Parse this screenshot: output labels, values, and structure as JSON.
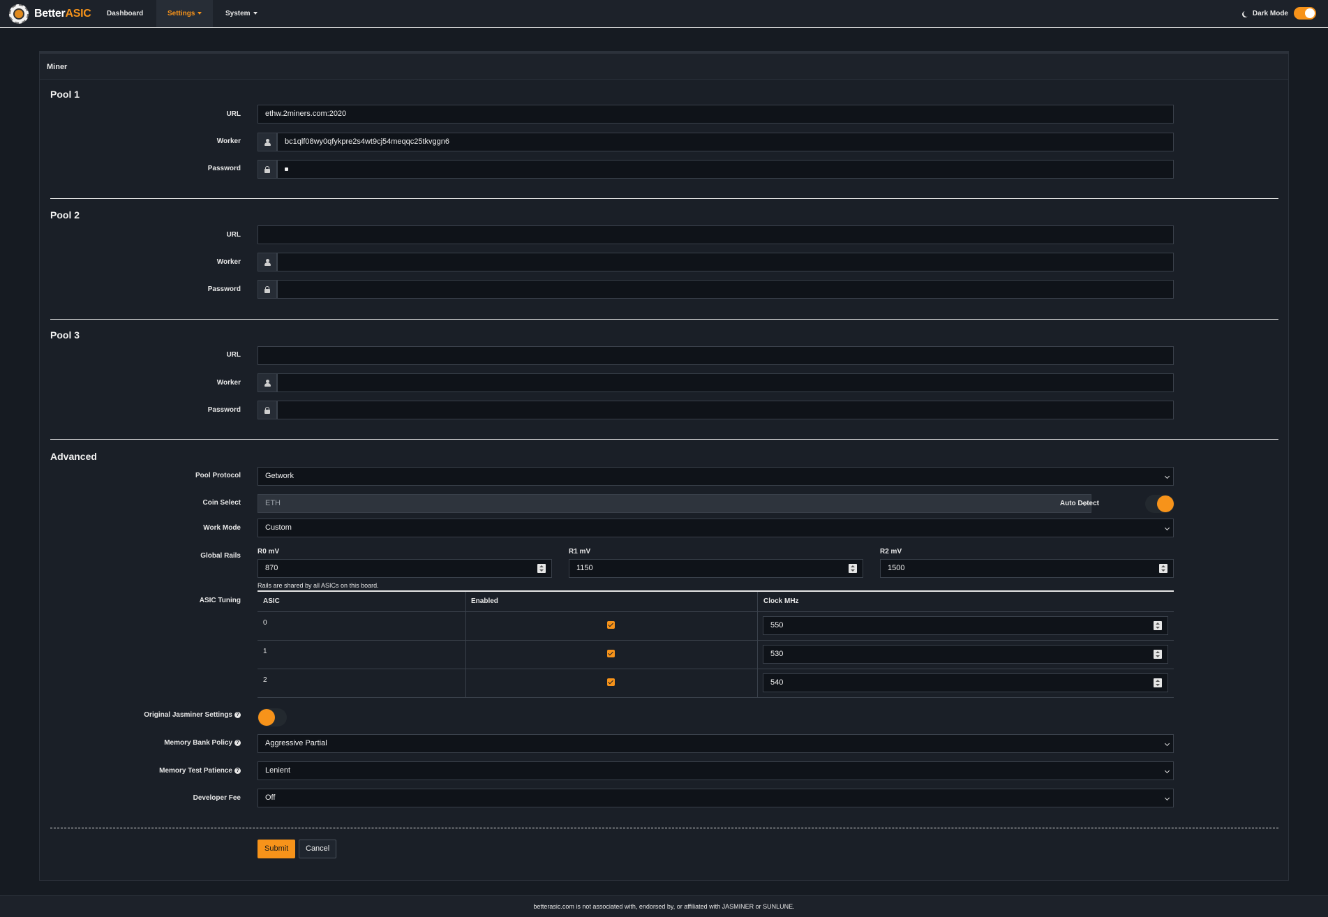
{
  "nav": {
    "brand_part1": "Better",
    "brand_part2": "ASIC",
    "items": [
      "Dashboard",
      "Settings",
      "System"
    ],
    "dark_mode_label": "Dark Mode"
  },
  "card": {
    "title": "Miner"
  },
  "labels": {
    "url": "URL",
    "worker": "Worker",
    "password": "Password"
  },
  "pools": [
    {
      "title": "Pool 1",
      "url": "ethw.2miners.com:2020",
      "worker": "bc1qlf08wy0qfykpre2s4wt9cj54meqqc25tkvggn6",
      "password_masked": true
    },
    {
      "title": "Pool 2",
      "url": "",
      "worker": "",
      "password_masked": false
    },
    {
      "title": "Pool 3",
      "url": "",
      "worker": "",
      "password_masked": false
    }
  ],
  "advanced": {
    "title": "Advanced",
    "pool_protocol_label": "Pool Protocol",
    "pool_protocol": "Getwork",
    "coin_select_label": "Coin Select",
    "coin_select": "ETH",
    "auto_detect_label": "Auto Detect",
    "work_mode_label": "Work Mode",
    "work_mode": "Custom",
    "global_rails_label": "Global Rails",
    "rails": [
      {
        "label": "R0 mV",
        "value": "870"
      },
      {
        "label": "R1 mV",
        "value": "1150"
      },
      {
        "label": "R2 mV",
        "value": "1500"
      }
    ],
    "rails_help": "Rails are shared by all ASICs on this board.",
    "asic_tuning_label": "ASIC Tuning",
    "table_headers": [
      "ASIC",
      "Enabled",
      "Clock MHz"
    ],
    "asics": [
      {
        "asic": "0",
        "enabled": true,
        "clock": "550"
      },
      {
        "asic": "1",
        "enabled": true,
        "clock": "530"
      },
      {
        "asic": "2",
        "enabled": true,
        "clock": "540"
      }
    ],
    "original_jasminer_label": "Original Jasminer Settings",
    "memory_bank_policy_label": "Memory Bank Policy",
    "memory_bank_policy": "Aggressive Partial",
    "memory_test_patience_label": "Memory Test Patience",
    "memory_test_patience": "Lenient",
    "developer_fee_label": "Developer Fee",
    "developer_fee": "Off"
  },
  "buttons": {
    "submit": "Submit",
    "cancel": "Cancel"
  },
  "footer": {
    "text": "betterasic.com is not associated with, endorsed by, or affiliated with JASMINER or SUNLUNE."
  },
  "colors": {
    "accent": "#f7931a",
    "background": "#161b22",
    "card": "#1a1f27"
  },
  "icons": {
    "worker": "user-icon",
    "password": "lock-icon",
    "dark_mode": "moon-icon",
    "help": "question-circle-icon"
  }
}
